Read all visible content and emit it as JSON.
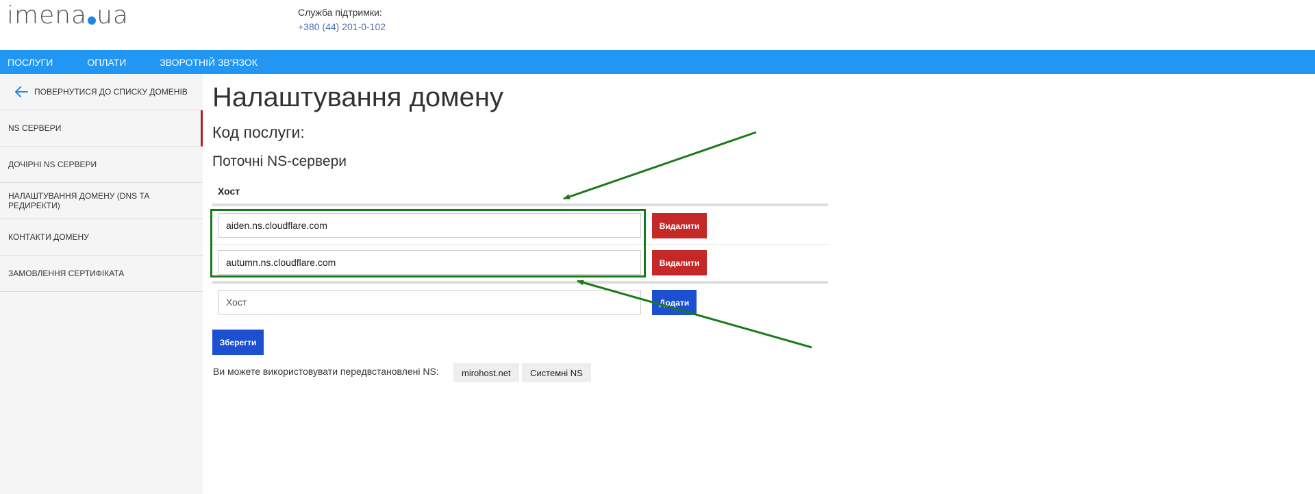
{
  "header": {
    "logo_left": "imena",
    "logo_right": "ua",
    "support_label": "Служба підтримки:",
    "support_phone": "+380 (44) 201-0-102"
  },
  "nav": {
    "items": [
      {
        "label": "ПОСЛУГИ"
      },
      {
        "label": "ОПЛАТИ"
      },
      {
        "label": "ЗВОРОТНІЙ ЗВ'ЯЗОК"
      }
    ]
  },
  "sidebar": {
    "back_label": "ПОВЕРНУТИСЯ ДО СПИСКУ ДОМЕНІВ",
    "items": [
      {
        "label": "NS СЕРВЕРИ",
        "active": true
      },
      {
        "label": "ДОЧІРНІ NS СЕРВЕРИ"
      },
      {
        "label": "НАЛАШТУВАННЯ ДОМЕНУ (DNS ТА РЕДИРЕКТИ)"
      },
      {
        "label": "КОНТАКТИ ДОМЕНУ"
      },
      {
        "label": "ЗАМОВЛЕННЯ СЕРТИФІКАТА"
      }
    ]
  },
  "main": {
    "title": "Налаштування домену",
    "service_code_label": "Код послуги:",
    "ns_heading": "Поточні NS-сервери",
    "host_column": "Хост",
    "ns_servers": [
      {
        "value": "aiden.ns.cloudflare.com",
        "delete_label": "Видалити"
      },
      {
        "value": "autumn.ns.cloudflare.com",
        "delete_label": "Видалити"
      }
    ],
    "new_host_placeholder": "Хост",
    "add_label": "Додати",
    "save_label": "Зберегти",
    "preset_text": "Ви можете використовувати передвстановлені NS:",
    "presets": [
      {
        "label": "mirohost.net"
      },
      {
        "label": "Системні NS"
      }
    ]
  },
  "colors": {
    "navbar": "#2196f3",
    "delete_button": "#c62828",
    "primary_button": "#1d4fd1",
    "annotation": "#1a7a1a",
    "active_indicator": "#b71c1c"
  }
}
